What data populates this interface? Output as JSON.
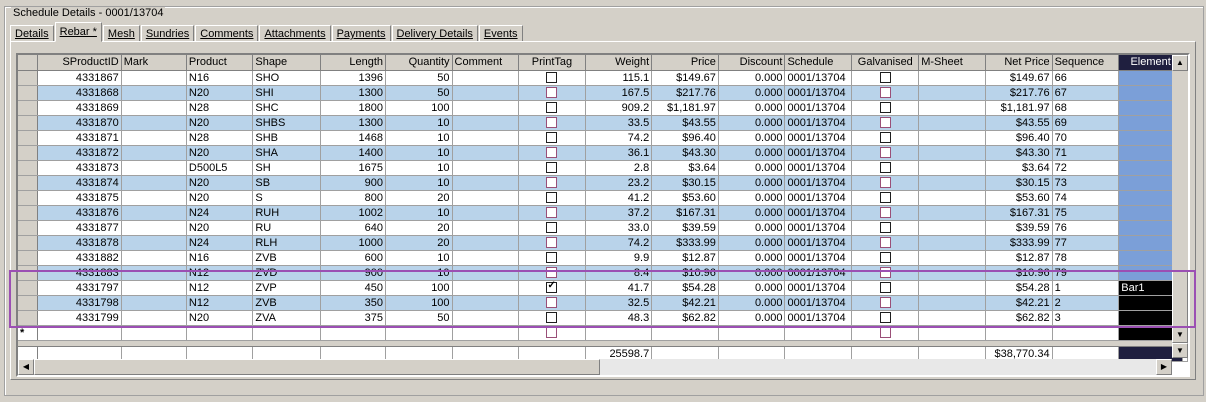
{
  "window": {
    "group_title": "Schedule Details - 0001/13704"
  },
  "tabs": [
    {
      "label": "Details",
      "active": false
    },
    {
      "label": "Rebar *",
      "active": true
    },
    {
      "label": "Mesh",
      "active": false
    },
    {
      "label": "Sundries",
      "active": false
    },
    {
      "label": "Comments",
      "active": false
    },
    {
      "label": "Attachments",
      "active": false
    },
    {
      "label": "Payments",
      "active": false
    },
    {
      "label": "Delivery Details",
      "active": false
    },
    {
      "label": "Events",
      "active": false
    }
  ],
  "columns": [
    "SProductID",
    "Mark",
    "Product",
    "Shape",
    "Length",
    "Quantity",
    "Comment",
    "PrintTag",
    "Weight",
    "Price",
    "Discount",
    "Schedule",
    "Galvanised",
    "M-Sheet",
    "Net Price",
    "Sequence",
    "Element"
  ],
  "rows": [
    {
      "id": "4331867",
      "mark": "",
      "product": "N16",
      "shape": "SHO",
      "length": "1396",
      "qty": "50",
      "comment": "",
      "printtag": false,
      "weight": "115.1",
      "price": "$149.67",
      "discount": "0.000",
      "schedule": "0001/13704",
      "galv": false,
      "msheet": "",
      "net": "$149.67",
      "seq": "66",
      "element": ""
    },
    {
      "id": "4331868",
      "mark": "",
      "product": "N20",
      "shape": "SHI",
      "length": "1300",
      "qty": "50",
      "comment": "",
      "printtag": false,
      "weight": "167.5",
      "price": "$217.76",
      "discount": "0.000",
      "schedule": "0001/13704",
      "galv": false,
      "msheet": "",
      "net": "$217.76",
      "seq": "67",
      "element": ""
    },
    {
      "id": "4331869",
      "mark": "",
      "product": "N28",
      "shape": "SHC",
      "length": "1800",
      "qty": "100",
      "comment": "",
      "printtag": false,
      "weight": "909.2",
      "price": "$1,181.97",
      "discount": "0.000",
      "schedule": "0001/13704",
      "galv": false,
      "msheet": "",
      "net": "$1,181.97",
      "seq": "68",
      "element": ""
    },
    {
      "id": "4331870",
      "mark": "",
      "product": "N20",
      "shape": "SHBS",
      "length": "1300",
      "qty": "10",
      "comment": "",
      "printtag": false,
      "weight": "33.5",
      "price": "$43.55",
      "discount": "0.000",
      "schedule": "0001/13704",
      "galv": false,
      "msheet": "",
      "net": "$43.55",
      "seq": "69",
      "element": ""
    },
    {
      "id": "4331871",
      "mark": "",
      "product": "N28",
      "shape": "SHB",
      "length": "1468",
      "qty": "10",
      "comment": "",
      "printtag": false,
      "weight": "74.2",
      "price": "$96.40",
      "discount": "0.000",
      "schedule": "0001/13704",
      "galv": false,
      "msheet": "",
      "net": "$96.40",
      "seq": "70",
      "element": ""
    },
    {
      "id": "4331872",
      "mark": "",
      "product": "N20",
      "shape": "SHA",
      "length": "1400",
      "qty": "10",
      "comment": "",
      "printtag": false,
      "weight": "36.1",
      "price": "$43.30",
      "discount": "0.000",
      "schedule": "0001/13704",
      "galv": false,
      "msheet": "",
      "net": "$43.30",
      "seq": "71",
      "element": ""
    },
    {
      "id": "4331873",
      "mark": "",
      "product": "D500L5",
      "shape": "SH",
      "length": "1675",
      "qty": "10",
      "comment": "",
      "printtag": false,
      "weight": "2.8",
      "price": "$3.64",
      "discount": "0.000",
      "schedule": "0001/13704",
      "galv": false,
      "msheet": "",
      "net": "$3.64",
      "seq": "72",
      "element": ""
    },
    {
      "id": "4331874",
      "mark": "",
      "product": "N20",
      "shape": "SB",
      "length": "900",
      "qty": "10",
      "comment": "",
      "printtag": false,
      "weight": "23.2",
      "price": "$30.15",
      "discount": "0.000",
      "schedule": "0001/13704",
      "galv": false,
      "msheet": "",
      "net": "$30.15",
      "seq": "73",
      "element": ""
    },
    {
      "id": "4331875",
      "mark": "",
      "product": "N20",
      "shape": "S",
      "length": "800",
      "qty": "20",
      "comment": "",
      "printtag": false,
      "weight": "41.2",
      "price": "$53.60",
      "discount": "0.000",
      "schedule": "0001/13704",
      "galv": false,
      "msheet": "",
      "net": "$53.60",
      "seq": "74",
      "element": ""
    },
    {
      "id": "4331876",
      "mark": "",
      "product": "N24",
      "shape": "RUH",
      "length": "1002",
      "qty": "10",
      "comment": "",
      "printtag": false,
      "weight": "37.2",
      "price": "$167.31",
      "discount": "0.000",
      "schedule": "0001/13704",
      "galv": false,
      "msheet": "",
      "net": "$167.31",
      "seq": "75",
      "element": ""
    },
    {
      "id": "4331877",
      "mark": "",
      "product": "N20",
      "shape": "RU",
      "length": "640",
      "qty": "20",
      "comment": "",
      "printtag": false,
      "weight": "33.0",
      "price": "$39.59",
      "discount": "0.000",
      "schedule": "0001/13704",
      "galv": false,
      "msheet": "",
      "net": "$39.59",
      "seq": "76",
      "element": ""
    },
    {
      "id": "4331878",
      "mark": "",
      "product": "N24",
      "shape": "RLH",
      "length": "1000",
      "qty": "20",
      "comment": "",
      "printtag": false,
      "weight": "74.2",
      "price": "$333.99",
      "discount": "0.000",
      "schedule": "0001/13704",
      "galv": false,
      "msheet": "",
      "net": "$333.99",
      "seq": "77",
      "element": ""
    },
    {
      "id": "4331882",
      "mark": "",
      "product": "N16",
      "shape": "ZVB",
      "length": "600",
      "qty": "10",
      "comment": "",
      "printtag": false,
      "weight": "9.9",
      "price": "$12.87",
      "discount": "0.000",
      "schedule": "0001/13704",
      "galv": false,
      "msheet": "",
      "net": "$12.87",
      "seq": "78",
      "element": ""
    },
    {
      "id": "4331883",
      "mark": "",
      "product": "N12",
      "shape": "ZVD",
      "length": "900",
      "qty": "10",
      "comment": "",
      "printtag": false,
      "weight": "8.4",
      "price": "$10.96",
      "discount": "0.000",
      "schedule": "0001/13704",
      "galv": false,
      "msheet": "",
      "net": "$10.96",
      "seq": "79",
      "element": ""
    },
    {
      "id": "4331797",
      "mark": "",
      "product": "N12",
      "shape": "ZVP",
      "length": "450",
      "qty": "100",
      "comment": "",
      "printtag": true,
      "weight": "41.7",
      "price": "$54.28",
      "discount": "0.000",
      "schedule": "0001/13704",
      "galv": false,
      "msheet": "",
      "net": "$54.28",
      "seq": "1",
      "element": "Bar1"
    },
    {
      "id": "4331798",
      "mark": "",
      "product": "N12",
      "shape": "ZVB",
      "length": "350",
      "qty": "100",
      "comment": "",
      "printtag": false,
      "weight": "32.5",
      "price": "$42.21",
      "discount": "0.000",
      "schedule": "0001/13704",
      "galv": false,
      "msheet": "",
      "net": "$42.21",
      "seq": "2",
      "element": ""
    },
    {
      "id": "4331799",
      "mark": "",
      "product": "N20",
      "shape": "ZVA",
      "length": "375",
      "qty": "50",
      "comment": "",
      "printtag": false,
      "weight": "48.3",
      "price": "$62.82",
      "discount": "0.000",
      "schedule": "0001/13704",
      "galv": false,
      "msheet": "",
      "net": "$62.82",
      "seq": "3",
      "element": ""
    }
  ],
  "new_row_marker": "*",
  "totals": {
    "weight": "25598.7",
    "net": "$38,770.34"
  },
  "colors": {
    "row_alt": "#b9d3ea",
    "element_fill": "#7b9fd8",
    "highlight": "#9b4fb3"
  }
}
